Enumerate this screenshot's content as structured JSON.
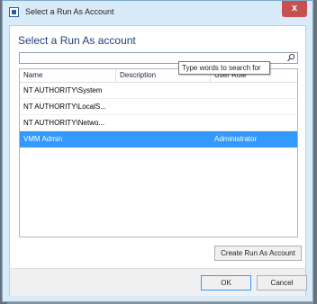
{
  "window": {
    "title": "Select a Run As Account",
    "close_glyph": "x"
  },
  "main": {
    "heading": "Select a Run As account",
    "search": {
      "value": "",
      "tooltip": "Type words to search for"
    },
    "columns": [
      "Name",
      "Description",
      "User Role"
    ],
    "rows": [
      {
        "name": "NT AUTHORITY\\System",
        "description": "",
        "role": ""
      },
      {
        "name": "NT AUTHORITY\\LocalS...",
        "description": "",
        "role": ""
      },
      {
        "name": "NT AUTHORITY\\Netwo...",
        "description": "",
        "role": ""
      },
      {
        "name": "VMM Admin",
        "description": "",
        "role": "Administrator",
        "selected": true
      }
    ],
    "create_button": "Create Run As Account"
  },
  "footer": {
    "ok": "OK",
    "cancel": "Cancel"
  },
  "colors": {
    "selection": "#3399ff",
    "heading": "#1e3e7a",
    "close": "#c75050"
  },
  "icons": {
    "app": "app-window-icon",
    "search": "search-icon"
  }
}
